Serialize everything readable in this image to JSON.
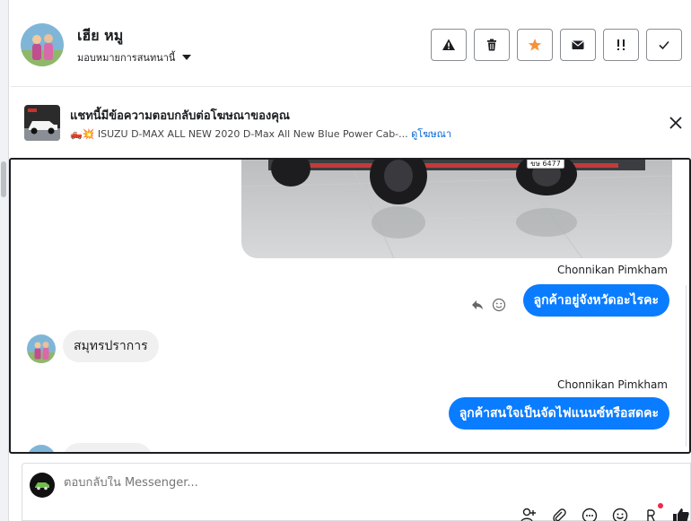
{
  "header": {
    "contact_name": "เฮีย หมู",
    "assign_label": "มอบหมายการสนทนานี้",
    "actions": [
      {
        "name": "spam-button",
        "icon": "warning-icon"
      },
      {
        "name": "delete-button",
        "icon": "trash-icon"
      },
      {
        "name": "star-button",
        "icon": "star-icon"
      },
      {
        "name": "mark-unread-button",
        "icon": "envelope-icon"
      },
      {
        "name": "follow-up-button",
        "icon": "exclamation-icon"
      },
      {
        "name": "mark-done-button",
        "icon": "check-icon"
      }
    ]
  },
  "ad_banner": {
    "title": "แชทนี้มีข้อความตอบกลับต่อโฆษณาของคุณ",
    "emoji": "🛻💥",
    "subtitle": "ISUZU D-MAX ALL NEW 2020 D-Max All New Blue Power Cab-...",
    "link": "ดูโฆษณา"
  },
  "messages": [
    {
      "type": "image",
      "direction": "out",
      "plate_text": "ขษ 6477"
    },
    {
      "type": "text",
      "direction": "out",
      "sender": "Chonnikan Pimkham",
      "text": "ลูกค้าอยู่จังหวัดอะไรคะ"
    },
    {
      "type": "text",
      "direction": "in",
      "text": "สมุทรปราการ"
    },
    {
      "type": "text",
      "direction": "out",
      "sender": "Chonnikan Pimkham",
      "text": "ลูกค้าสนใจเป็นจัดไฟแนนซ์หรือสดคะ"
    }
  ],
  "composer": {
    "placeholder": "ตอบกลับใน Messenger..."
  },
  "colors": {
    "outgoing_bubble": "#0a7cff",
    "incoming_bubble": "#f0f0f0",
    "star": "#f7923b",
    "link": "#0064d1"
  }
}
